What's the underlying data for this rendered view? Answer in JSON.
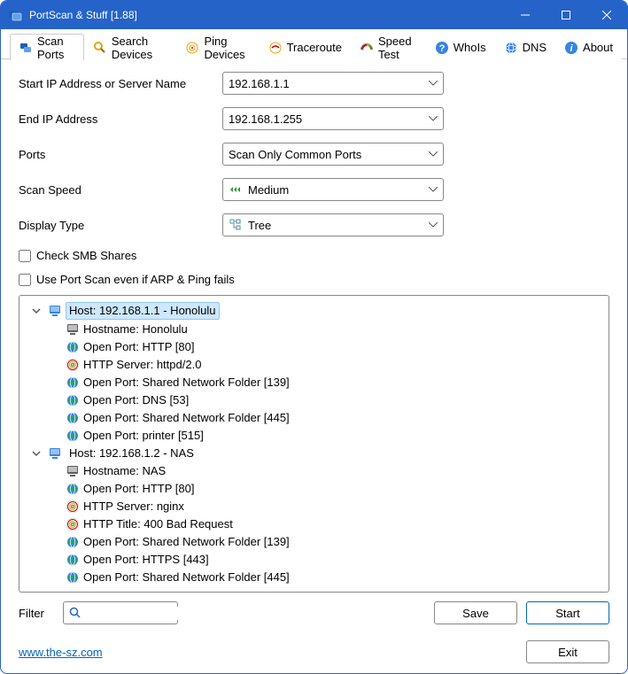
{
  "window": {
    "title": "PortScan & Stuff [1.88]"
  },
  "tabs": [
    {
      "label": "Scan Ports",
      "active": true,
      "icon": "scan"
    },
    {
      "label": "Search Devices",
      "active": false,
      "icon": "search"
    },
    {
      "label": "Ping Devices",
      "active": false,
      "icon": "ping"
    },
    {
      "label": "Traceroute",
      "active": false,
      "icon": "trace"
    },
    {
      "label": "Speed Test",
      "active": false,
      "icon": "speed"
    },
    {
      "label": "WhoIs",
      "active": false,
      "icon": "whois"
    },
    {
      "label": "DNS",
      "active": false,
      "icon": "dns"
    },
    {
      "label": "About",
      "active": false,
      "icon": "about"
    }
  ],
  "form": {
    "start_ip": {
      "label": "Start IP Address or Server Name",
      "value": "192.168.1.1"
    },
    "end_ip": {
      "label": "End IP Address",
      "value": "192.168.1.255"
    },
    "ports": {
      "label": "Ports",
      "value": "Scan Only Common Ports"
    },
    "speed": {
      "label": "Scan Speed",
      "value": "Medium"
    },
    "display": {
      "label": "Display Type",
      "value": "Tree"
    },
    "check_smb": {
      "label": "Check SMB Shares",
      "checked": false
    },
    "use_portscan": {
      "label": "Use Port Scan even if ARP & Ping fails",
      "checked": false
    }
  },
  "results": [
    {
      "label": "Host: 192.168.1.1 - Honolulu",
      "selected": true,
      "children": [
        {
          "icon": "host",
          "label": "Hostname: Honolulu"
        },
        {
          "icon": "port",
          "label": "Open Port: HTTP [80]"
        },
        {
          "icon": "http",
          "label": "HTTP Server: httpd/2.0"
        },
        {
          "icon": "port",
          "label": "Open Port: Shared Network Folder [139]"
        },
        {
          "icon": "port",
          "label": "Open Port: DNS [53]"
        },
        {
          "icon": "port",
          "label": "Open Port: Shared Network Folder [445]"
        },
        {
          "icon": "port",
          "label": "Open Port: printer [515]"
        }
      ]
    },
    {
      "label": "Host: 192.168.1.2 - NAS",
      "selected": false,
      "children": [
        {
          "icon": "host",
          "label": "Hostname: NAS"
        },
        {
          "icon": "port",
          "label": "Open Port: HTTP [80]"
        },
        {
          "icon": "http",
          "label": "HTTP Server: nginx"
        },
        {
          "icon": "http",
          "label": "HTTP Title: 400 Bad Request"
        },
        {
          "icon": "port",
          "label": "Open Port: Shared Network Folder [139]"
        },
        {
          "icon": "port",
          "label": "Open Port: HTTPS [443]"
        },
        {
          "icon": "port",
          "label": "Open Port: Shared Network Folder [445]"
        }
      ]
    }
  ],
  "bottom": {
    "filter_label": "Filter",
    "filter_value": "",
    "save_label": "Save",
    "start_label": "Start"
  },
  "footer": {
    "link": "www.the-sz.com",
    "exit_label": "Exit"
  }
}
